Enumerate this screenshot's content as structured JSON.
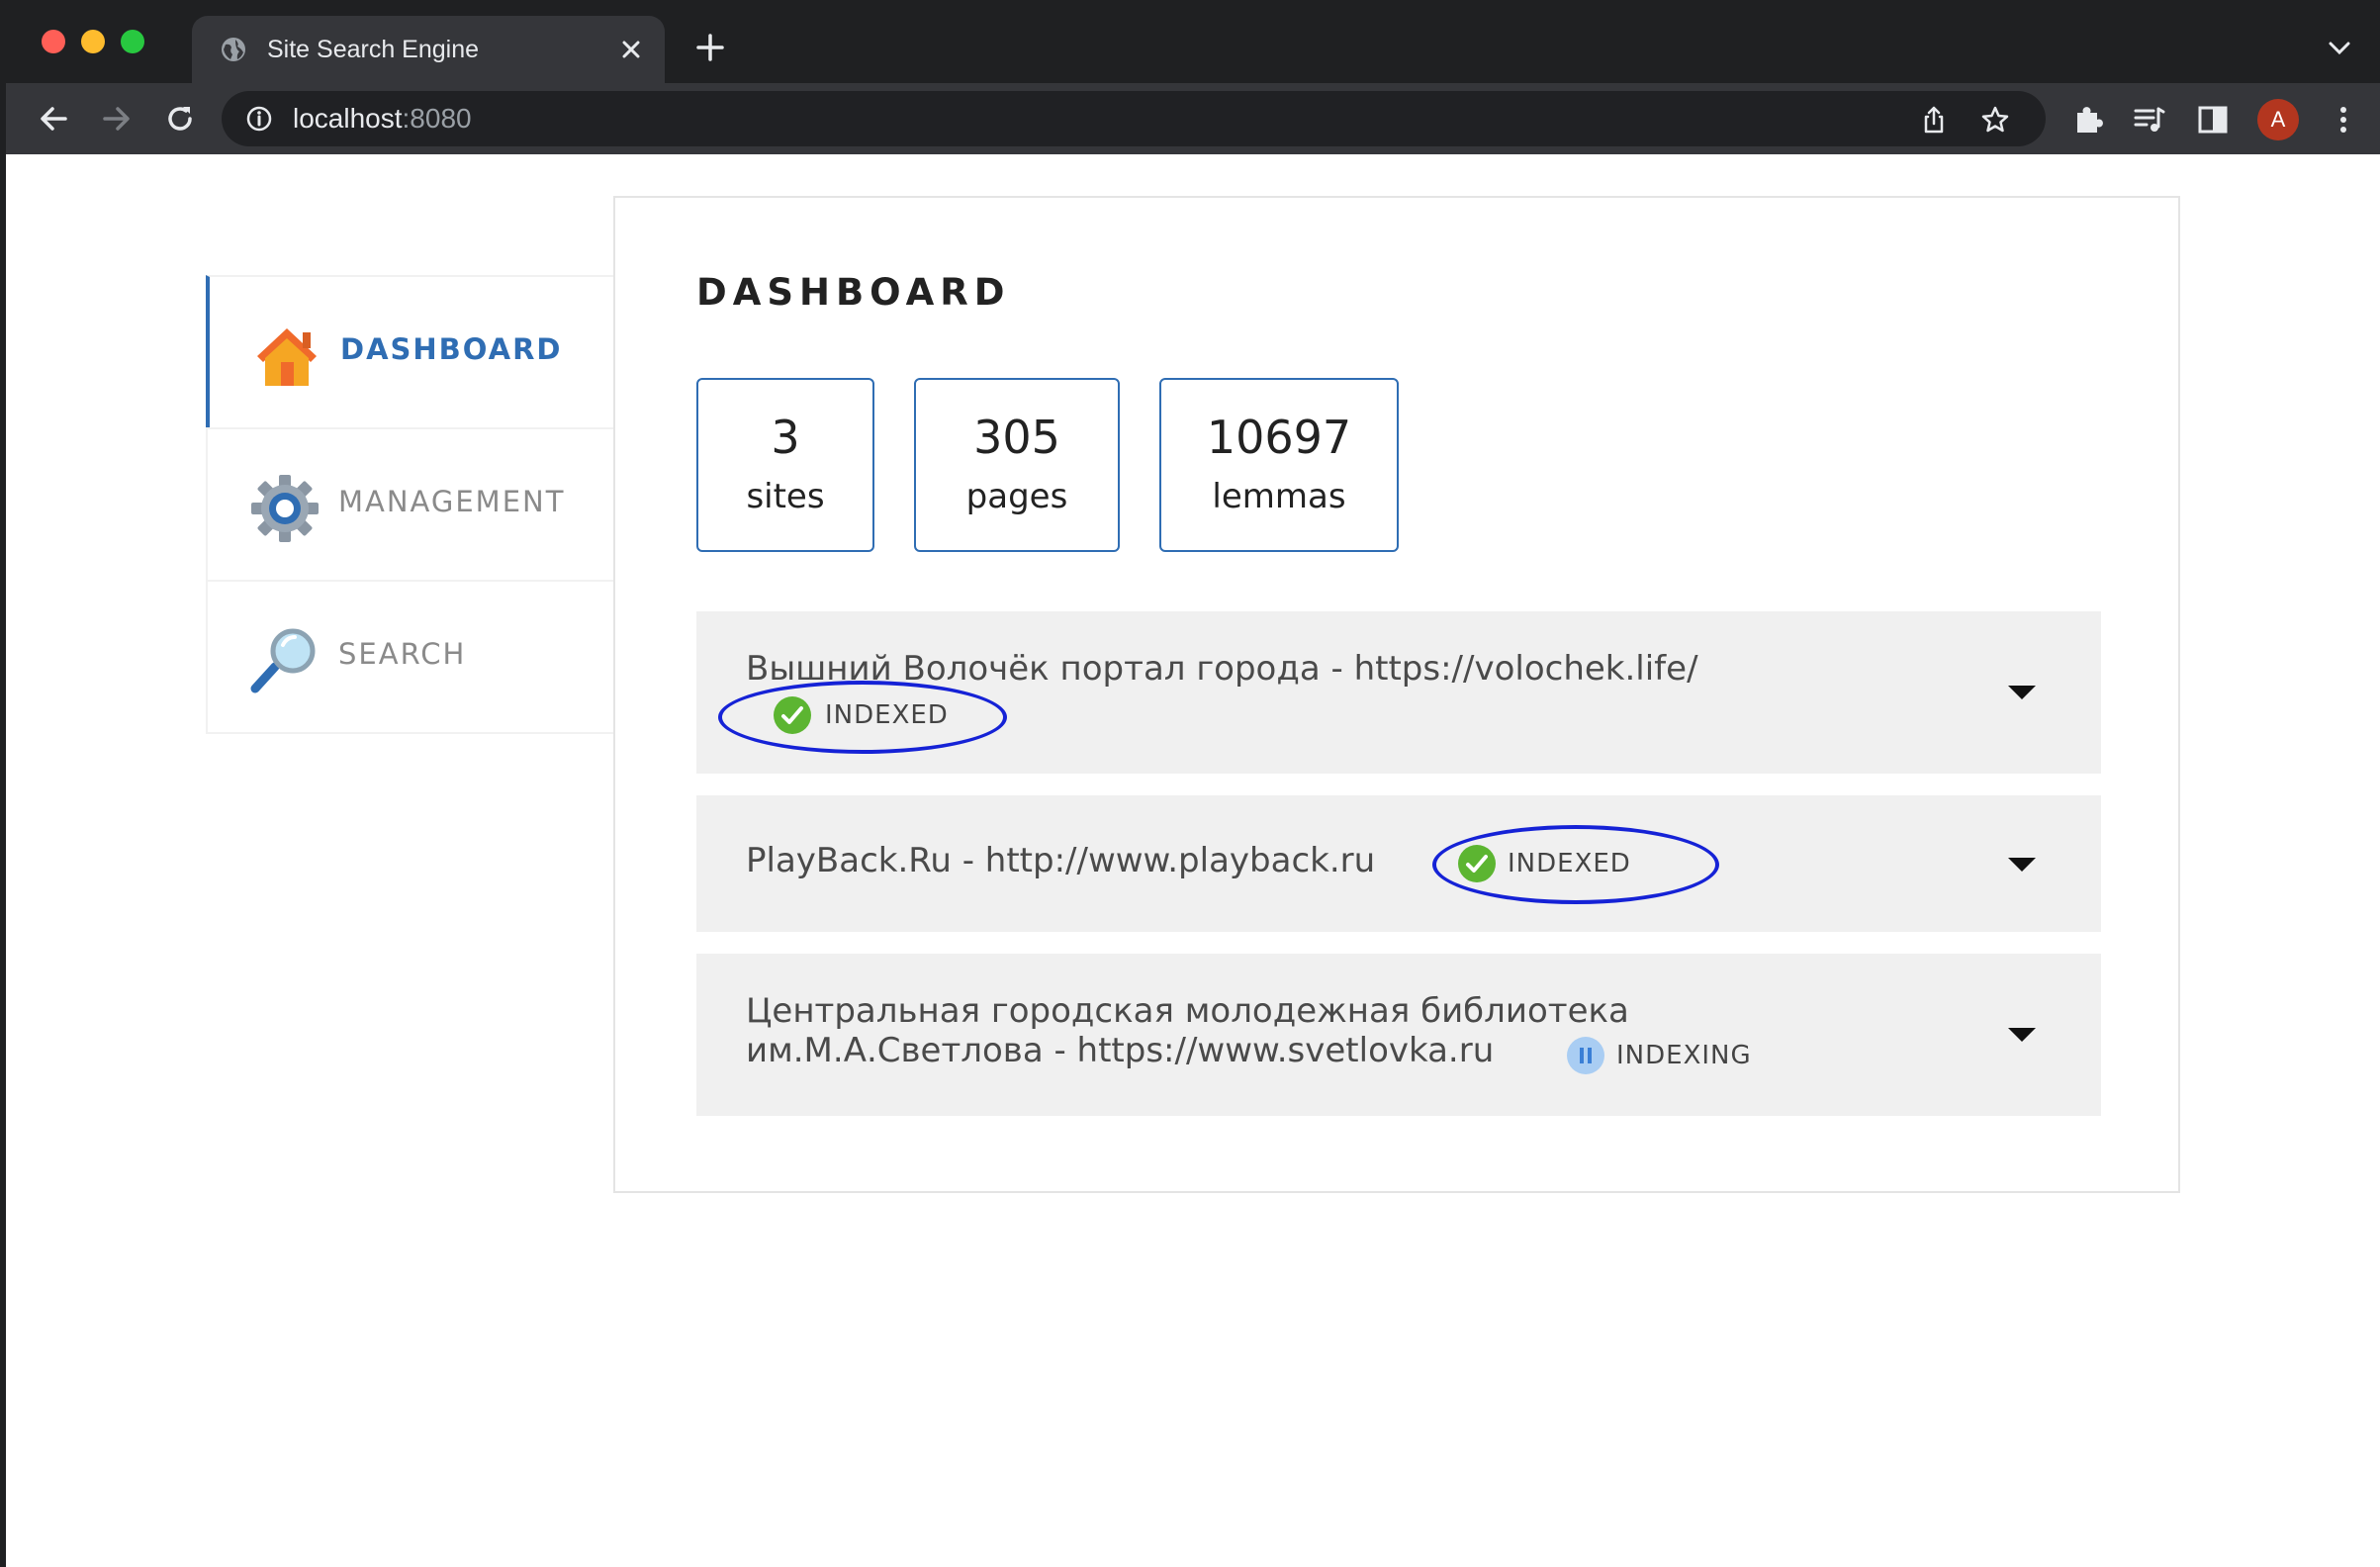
{
  "browser": {
    "tab_title": "Site Search Engine",
    "url_host": "localhost",
    "url_port": ":8080",
    "avatar_letter": "A"
  },
  "sidebar": {
    "items": [
      {
        "label": "DASHBOARD",
        "icon": "house-icon",
        "active": true
      },
      {
        "label": "MANAGEMENT",
        "icon": "gear-icon",
        "active": false
      },
      {
        "label": "SEARCH",
        "icon": "magnifier-icon",
        "active": false
      }
    ]
  },
  "dashboard": {
    "title": "DASHBOARD",
    "stats": [
      {
        "value": "3",
        "label": "sites"
      },
      {
        "value": "305",
        "label": "pages"
      },
      {
        "value": "10697",
        "label": "lemmas"
      }
    ],
    "sites": [
      {
        "line1": "Вышний Волочёк портал города - https://volochek.life/",
        "line2": "",
        "status": "INDEXED",
        "status_icon": "check-circle-icon"
      },
      {
        "line1": "PlayBack.Ru - http://www.playback.ru",
        "line2": "",
        "status": "INDEXED",
        "status_icon": "check-circle-icon"
      },
      {
        "line1": "Центральная городская молодежная библиотека",
        "line2": "им.М.А.Светлова - https://www.svetlovka.ru",
        "status": "INDEXING",
        "status_icon": "pause-circle-icon"
      }
    ]
  },
  "colors": {
    "accent": "#2f6db3",
    "annotation": "#1522d6",
    "indexed": "#5cb531",
    "indexing": "#4a8fe0"
  }
}
